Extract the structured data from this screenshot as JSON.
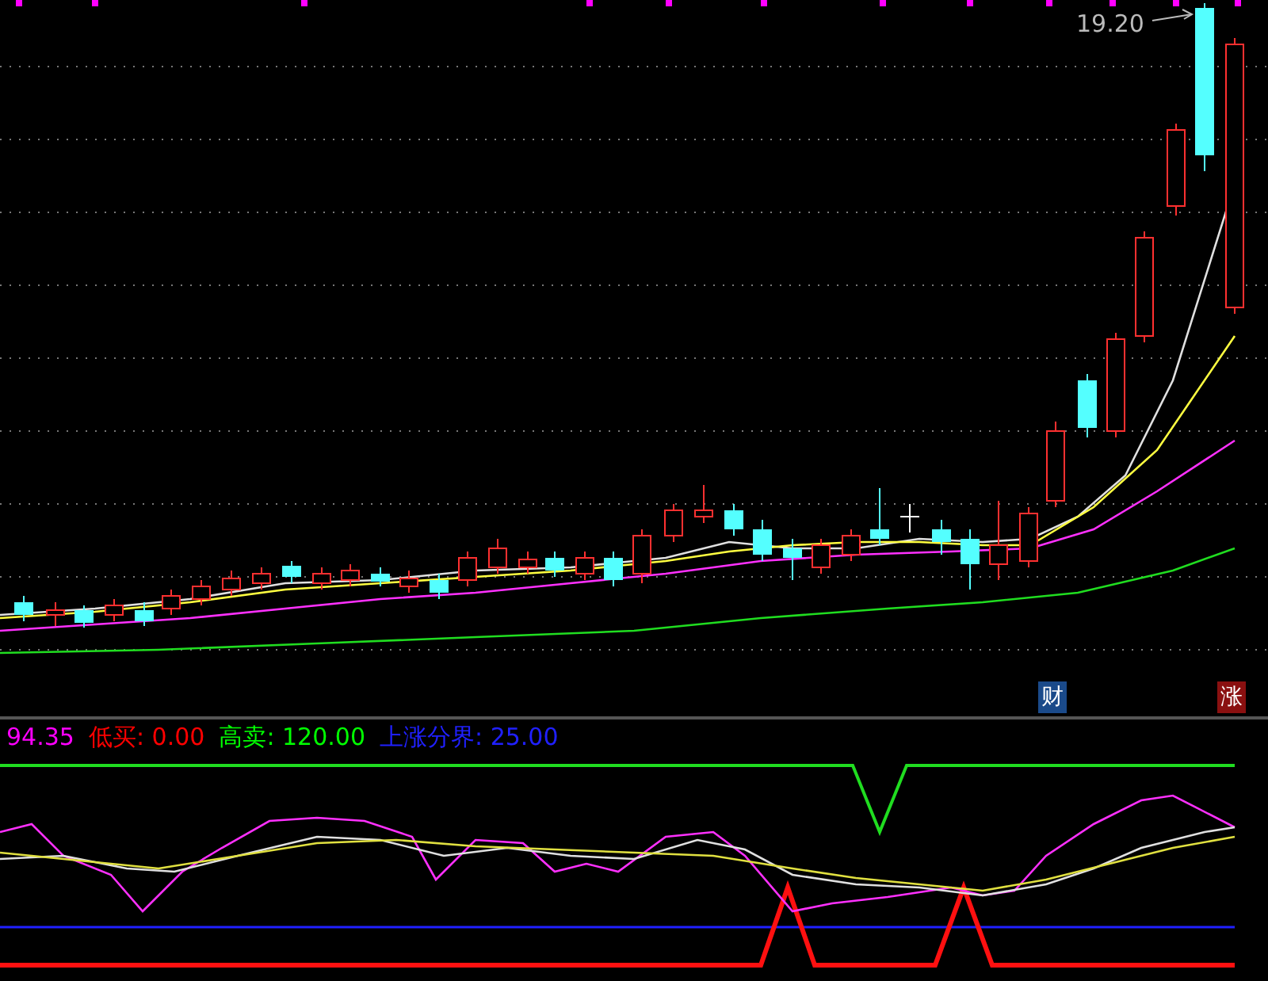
{
  "price_chart": {
    "high_label": "19.20",
    "markers": [
      {
        "text": "财",
        "color": "#1a4a8a"
      },
      {
        "text": "涨",
        "color": "#8a1010"
      }
    ]
  },
  "indicator": {
    "legend": [
      {
        "text": "94.35",
        "color": "#ff00ff"
      },
      {
        "text": "低买: 0.00",
        "color": "#ff0000"
      },
      {
        "text": "高卖: 120.00",
        "color": "#00ff00"
      },
      {
        "text": "上涨分界: 25.00",
        "color": "#2020ff"
      }
    ]
  }
}
